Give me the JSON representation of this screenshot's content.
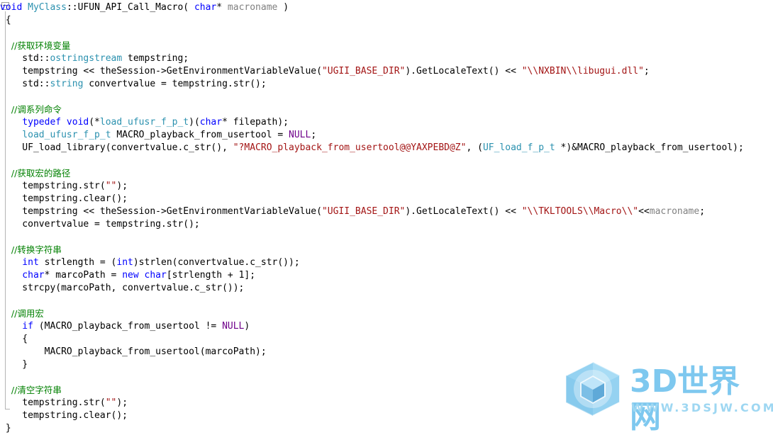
{
  "editor": {
    "language": "cpp",
    "outline_marker": "−",
    "colors": {
      "background": "#ffffff",
      "plain": "#000000",
      "keyword": "#0000ff",
      "type": "#2b91af",
      "comment": "#008000",
      "string": "#a31515",
      "macro": "#6f008a",
      "parameter": "#808080",
      "outline_guide": "#b4b4b4"
    },
    "lines": [
      {
        "id": "line-1",
        "indent": 0,
        "tokens": [
          {
            "t": "void ",
            "c": "kw"
          },
          {
            "t": "MyClass",
            "c": "type"
          },
          {
            "t": "::UFUN_API_Call_Macro( ",
            "c": "plain"
          },
          {
            "t": "char",
            "c": "kw"
          },
          {
            "t": "* ",
            "c": "plain"
          },
          {
            "t": "macroname",
            "c": "param"
          },
          {
            "t": " )",
            "c": "plain"
          }
        ]
      },
      {
        "id": "line-2",
        "indent": 0,
        "tokens": [
          {
            "t": " {",
            "c": "plain"
          }
        ]
      },
      {
        "id": "line-3",
        "indent": 0,
        "tokens": []
      },
      {
        "id": "line-4",
        "indent": 1,
        "tokens": [
          {
            "t": "//获取环境变量",
            "c": "comment"
          }
        ]
      },
      {
        "id": "line-5",
        "indent": 1,
        "tokens": [
          {
            "t": "std::",
            "c": "plain"
          },
          {
            "t": "ostringstream",
            "c": "type"
          },
          {
            "t": " tempstring;",
            "c": "plain"
          }
        ]
      },
      {
        "id": "line-6",
        "indent": 1,
        "tokens": [
          {
            "t": "tempstring << theSession->GetEnvironmentVariableValue(",
            "c": "plain"
          },
          {
            "t": "\"UGII_BASE_DIR\"",
            "c": "string"
          },
          {
            "t": ").GetLocaleText() << ",
            "c": "plain"
          },
          {
            "t": "\"\\\\NXBIN\\\\libugui.dll\"",
            "c": "string"
          },
          {
            "t": ";",
            "c": "plain"
          }
        ]
      },
      {
        "id": "line-7",
        "indent": 1,
        "tokens": [
          {
            "t": "std::",
            "c": "plain"
          },
          {
            "t": "string",
            "c": "type"
          },
          {
            "t": " convertvalue = tempstring.str();",
            "c": "plain"
          }
        ]
      },
      {
        "id": "line-8",
        "indent": 0,
        "tokens": []
      },
      {
        "id": "line-9",
        "indent": 1,
        "tokens": [
          {
            "t": "//调系列命令",
            "c": "comment"
          }
        ]
      },
      {
        "id": "line-10",
        "indent": 1,
        "tokens": [
          {
            "t": "typedef void",
            "c": "kw"
          },
          {
            "t": "(*",
            "c": "plain"
          },
          {
            "t": "load_ufusr_f_p_t",
            "c": "type"
          },
          {
            "t": ")(",
            "c": "plain"
          },
          {
            "t": "char",
            "c": "kw"
          },
          {
            "t": "* filepath);",
            "c": "plain"
          }
        ]
      },
      {
        "id": "line-11",
        "indent": 1,
        "tokens": [
          {
            "t": "load_ufusr_f_p_t",
            "c": "type"
          },
          {
            "t": " MACRO_playback_from_usertool = ",
            "c": "plain"
          },
          {
            "t": "NULL",
            "c": "macro"
          },
          {
            "t": ";",
            "c": "plain"
          }
        ]
      },
      {
        "id": "line-12",
        "indent": 1,
        "tokens": [
          {
            "t": "UF_load_library(convertvalue.c_str(), ",
            "c": "plain"
          },
          {
            "t": "\"?MACRO_playback_from_usertool@@YAXPEBD@Z\"",
            "c": "string"
          },
          {
            "t": ", (",
            "c": "plain"
          },
          {
            "t": "UF_load_f_p_t",
            "c": "type"
          },
          {
            "t": " *)&MACRO_playback_from_usertool);",
            "c": "plain"
          }
        ]
      },
      {
        "id": "line-13",
        "indent": 0,
        "tokens": []
      },
      {
        "id": "line-14",
        "indent": 1,
        "tokens": [
          {
            "t": "//获取宏的路径",
            "c": "comment"
          }
        ]
      },
      {
        "id": "line-15",
        "indent": 1,
        "tokens": [
          {
            "t": "tempstring.str(",
            "c": "plain"
          },
          {
            "t": "\"\"",
            "c": "string"
          },
          {
            "t": ");",
            "c": "plain"
          }
        ]
      },
      {
        "id": "line-16",
        "indent": 1,
        "tokens": [
          {
            "t": "tempstring.clear();",
            "c": "plain"
          }
        ]
      },
      {
        "id": "line-17",
        "indent": 1,
        "tokens": [
          {
            "t": "tempstring << theSession->GetEnvironmentVariableValue(",
            "c": "plain"
          },
          {
            "t": "\"UGII_BASE_DIR\"",
            "c": "string"
          },
          {
            "t": ").GetLocaleText() << ",
            "c": "plain"
          },
          {
            "t": "\"\\\\TKLTOOLS\\\\Macro\\\\\"",
            "c": "string"
          },
          {
            "t": "<<",
            "c": "plain"
          },
          {
            "t": "macroname",
            "c": "param"
          },
          {
            "t": ";",
            "c": "plain"
          }
        ]
      },
      {
        "id": "line-18",
        "indent": 1,
        "tokens": [
          {
            "t": "convertvalue = tempstring.str();",
            "c": "plain"
          }
        ]
      },
      {
        "id": "line-19",
        "indent": 0,
        "tokens": []
      },
      {
        "id": "line-20",
        "indent": 1,
        "tokens": [
          {
            "t": "//转换字符串",
            "c": "comment"
          }
        ]
      },
      {
        "id": "line-21",
        "indent": 1,
        "tokens": [
          {
            "t": "int",
            "c": "kw"
          },
          {
            "t": " strlength = (",
            "c": "plain"
          },
          {
            "t": "int",
            "c": "kw"
          },
          {
            "t": ")strlen(convertvalue.c_str());",
            "c": "plain"
          }
        ]
      },
      {
        "id": "line-22",
        "indent": 1,
        "tokens": [
          {
            "t": "char",
            "c": "kw"
          },
          {
            "t": "* marcoPath = ",
            "c": "plain"
          },
          {
            "t": "new char",
            "c": "kw"
          },
          {
            "t": "[strlength + 1];",
            "c": "plain"
          }
        ]
      },
      {
        "id": "line-23",
        "indent": 1,
        "tokens": [
          {
            "t": "strcpy(marcoPath, convertvalue.c_str());",
            "c": "plain"
          }
        ]
      },
      {
        "id": "line-24",
        "indent": 0,
        "tokens": []
      },
      {
        "id": "line-25",
        "indent": 1,
        "tokens": [
          {
            "t": "//调用宏",
            "c": "comment"
          }
        ]
      },
      {
        "id": "line-26",
        "indent": 1,
        "tokens": [
          {
            "t": "if",
            "c": "kw"
          },
          {
            "t": " (MACRO_playback_from_usertool != ",
            "c": "plain"
          },
          {
            "t": "NULL",
            "c": "macro"
          },
          {
            "t": ")",
            "c": "plain"
          }
        ]
      },
      {
        "id": "line-27",
        "indent": 1,
        "tokens": [
          {
            "t": "{",
            "c": "plain"
          }
        ]
      },
      {
        "id": "line-28",
        "indent": 2,
        "tokens": [
          {
            "t": "MACRO_playback_from_usertool(marcoPath);",
            "c": "plain"
          }
        ]
      },
      {
        "id": "line-29",
        "indent": 1,
        "tokens": [
          {
            "t": "}",
            "c": "plain"
          }
        ]
      },
      {
        "id": "line-30",
        "indent": 0,
        "tokens": []
      },
      {
        "id": "line-31",
        "indent": 1,
        "tokens": [
          {
            "t": "//清空字符串",
            "c": "comment"
          }
        ]
      },
      {
        "id": "line-32",
        "indent": 1,
        "tokens": [
          {
            "t": "tempstring.str(",
            "c": "plain"
          },
          {
            "t": "\"\"",
            "c": "string"
          },
          {
            "t": ");",
            "c": "plain"
          }
        ]
      },
      {
        "id": "line-33",
        "indent": 1,
        "tokens": [
          {
            "t": "tempstring.clear();",
            "c": "plain"
          }
        ]
      },
      {
        "id": "line-34",
        "indent": 0,
        "tokens": [
          {
            "t": " }",
            "c": "plain"
          }
        ]
      }
    ]
  },
  "watermark": {
    "brand": "3D世界网",
    "url": "WWW.3DSJW.COM",
    "logo_colors": {
      "outer": "#7ec8ef",
      "inner": "#a8dcf5",
      "cube": "#6fb9e3"
    }
  }
}
